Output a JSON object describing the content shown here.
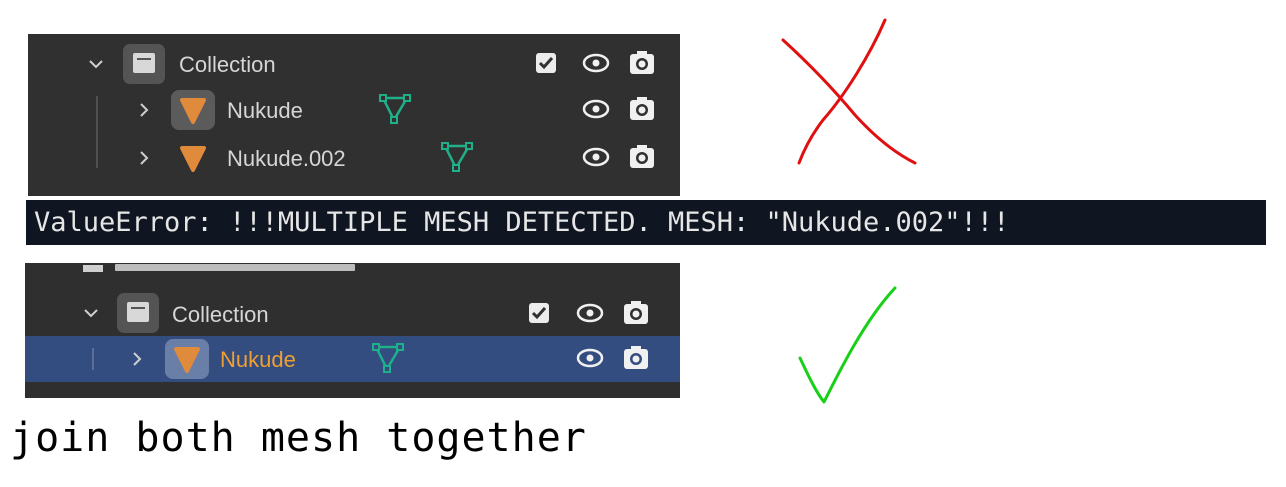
{
  "top_outliner": {
    "collection_label": "Collection",
    "items": [
      {
        "label": "Nukude"
      },
      {
        "label": "Nukude.002"
      }
    ]
  },
  "error_message": "ValueError: !!!MULTIPLE MESH DETECTED. MESH: \"Nukude.002\"!!!",
  "bottom_outliner": {
    "collection_label": "Collection",
    "items": [
      {
        "label": "Nukude",
        "selected": true
      }
    ]
  },
  "caption": "join both mesh together",
  "colors": {
    "panel_bg": "#303030",
    "selected_row": "#334d80",
    "active_label": "#f0a030",
    "mesh_object_icon": "#e08a3c",
    "mesh_data_icon": "#1fb08a",
    "error_bar_bg": "#101522",
    "cross_mark": "#e01010",
    "check_mark": "#18d018"
  },
  "icons": [
    "chevron-down-icon",
    "chevron-right-icon",
    "collection-icon",
    "mesh-object-icon",
    "mesh-data-icon",
    "checkbox-checked-icon",
    "eye-icon",
    "camera-icon",
    "cross-mark-icon",
    "check-mark-icon"
  ]
}
